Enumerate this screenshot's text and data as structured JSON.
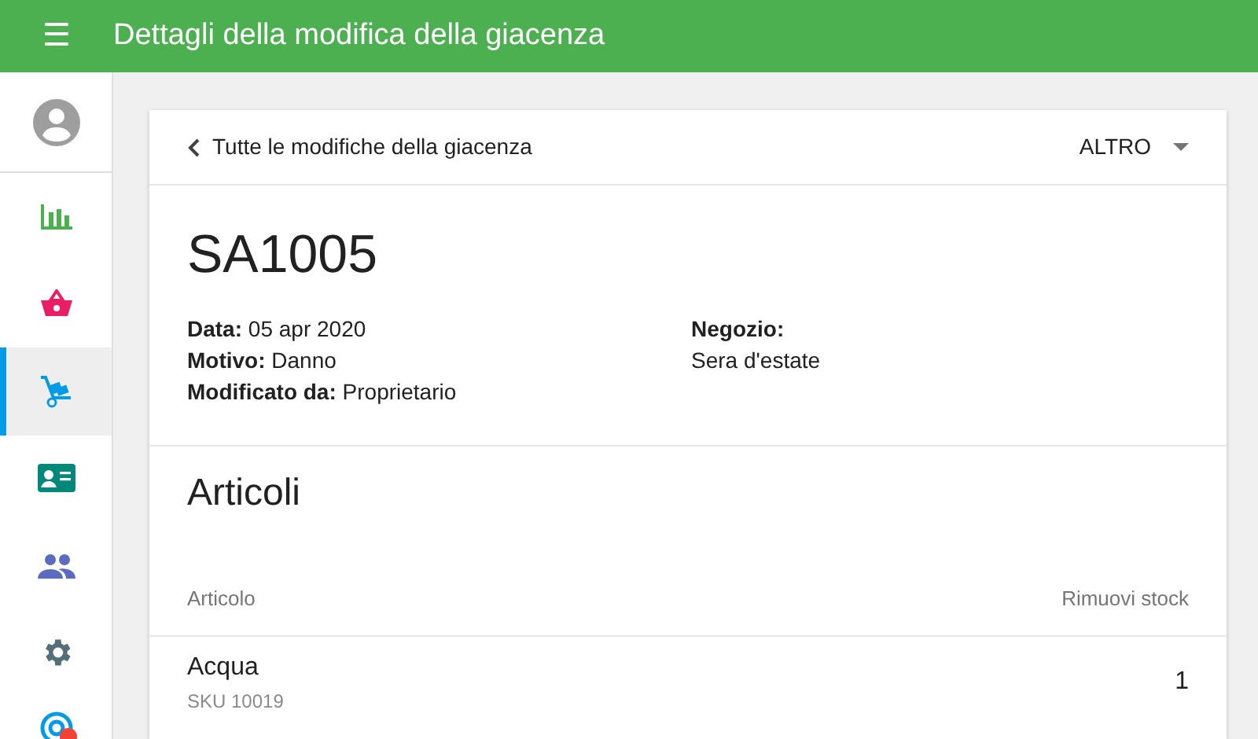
{
  "app_bar": {
    "menu_icon": "☰",
    "title": "Dettagli della modifica della giacenza"
  },
  "sidebar": {
    "items": [
      {
        "kind": "chart",
        "selected": false,
        "notification": false
      },
      {
        "kind": "basket",
        "selected": false,
        "notification": false
      },
      {
        "kind": "trolley",
        "selected": true,
        "notification": false
      },
      {
        "kind": "card",
        "selected": false,
        "notification": false
      },
      {
        "kind": "people",
        "selected": false,
        "notification": false
      },
      {
        "kind": "gear",
        "selected": false,
        "notification": false
      },
      {
        "kind": "target",
        "selected": false,
        "notification": true
      }
    ]
  },
  "card": {
    "back_link": "Tutte le modifiche della giacenza",
    "menu_button": "ALTRO",
    "title": "SA1005",
    "details_left": [
      {
        "label": "Data:",
        "value": "05 apr 2020"
      },
      {
        "label": "Motivo:",
        "value": "Danno"
      },
      {
        "label": "Modificato da:",
        "value": "Proprietario"
      }
    ],
    "details_right": [
      {
        "label": "Negozio:",
        "value": "Sera d'estate"
      }
    ],
    "section_title": "Articoli",
    "table": {
      "columns": [
        "Articolo",
        "Rimuovi stock"
      ],
      "rows": [
        {
          "name": "Acqua",
          "sku": "SKU 10019",
          "quantity": "1"
        }
      ]
    }
  }
}
